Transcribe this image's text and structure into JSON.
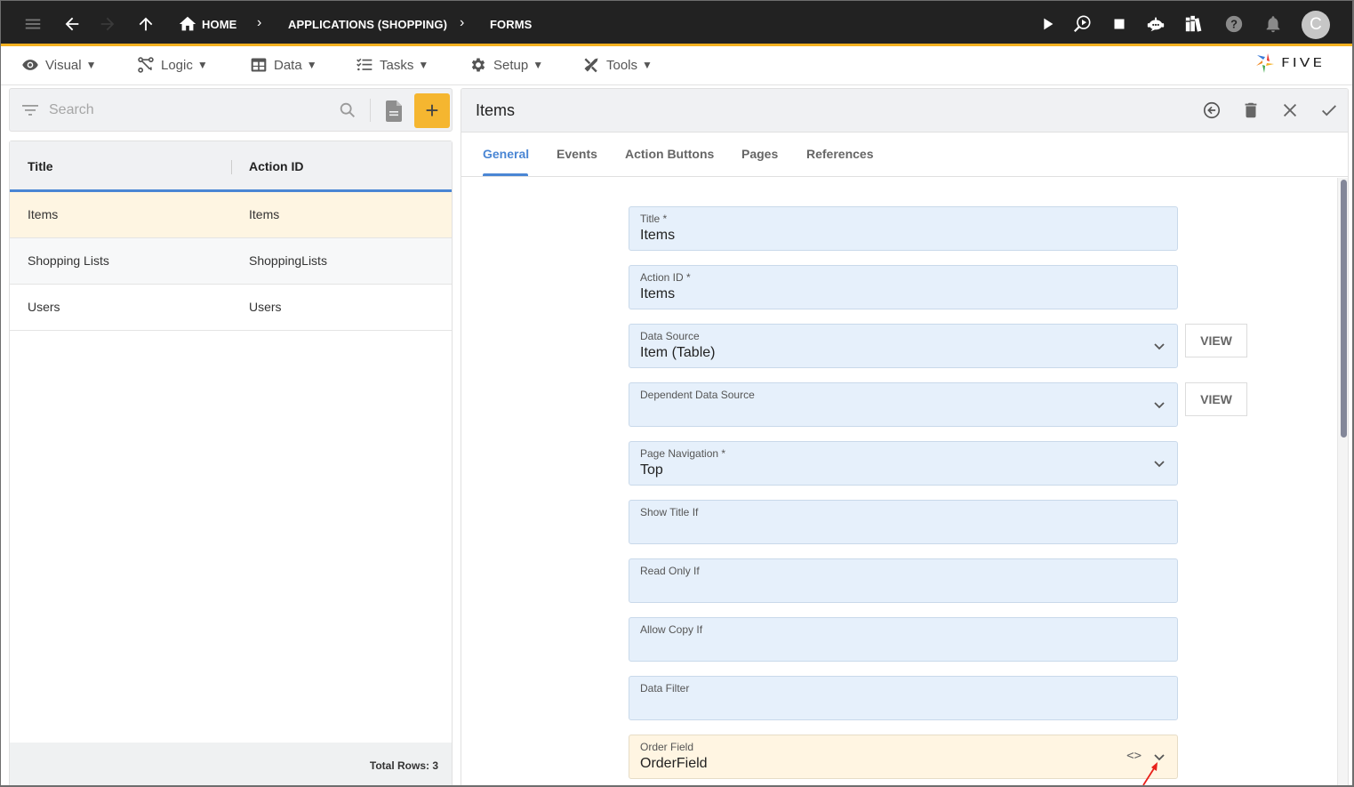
{
  "topbar": {
    "breadcrumbs": [
      "HOME",
      "APPLICATIONS (SHOPPING)",
      "FORMS"
    ],
    "avatar_initial": "C",
    "icons": [
      "menu-icon",
      "back-arrow-icon",
      "forward-arrow-icon",
      "up-arrow-icon",
      "home-icon",
      "run-icon",
      "inspect-run-icon",
      "stop-icon",
      "chat-bot-icon",
      "library-icon",
      "help-icon",
      "bell-icon"
    ]
  },
  "menubar": {
    "items": [
      {
        "label": "Visual",
        "icon": "eye-icon"
      },
      {
        "label": "Logic",
        "icon": "logic-icon"
      },
      {
        "label": "Data",
        "icon": "table-icon"
      },
      {
        "label": "Tasks",
        "icon": "checklist-icon"
      },
      {
        "label": "Setup",
        "icon": "gear-icon"
      },
      {
        "label": "Tools",
        "icon": "tools-icon"
      }
    ],
    "caret": "▼",
    "logo_text": "FIVE"
  },
  "search": {
    "placeholder": "Search",
    "value": "",
    "add_label": "+"
  },
  "list": {
    "columns": [
      "Title",
      "Action ID"
    ],
    "rows": [
      {
        "title": "Items",
        "action_id": "Items",
        "selected": true
      },
      {
        "title": "Shopping Lists",
        "action_id": "ShoppingLists",
        "selected": false
      },
      {
        "title": "Users",
        "action_id": "Users",
        "selected": false
      }
    ],
    "total_label": "Total Rows: 3"
  },
  "form": {
    "title": "Items",
    "tabs": [
      "General",
      "Events",
      "Action Buttons",
      "Pages",
      "References"
    ],
    "active_tab": "General",
    "fields": [
      {
        "label": "Title *",
        "value": "Items"
      },
      {
        "label": "Action ID *",
        "value": "Items"
      },
      {
        "label": "Data Source",
        "value": "Item (Table)"
      },
      {
        "label": "Dependent Data Source",
        "value": ""
      },
      {
        "label": "Page Navigation *",
        "value": "Top"
      },
      {
        "label": "Show Title If",
        "value": ""
      },
      {
        "label": "Read Only If",
        "value": ""
      },
      {
        "label": "Allow Copy If",
        "value": ""
      },
      {
        "label": "Data Filter",
        "value": ""
      },
      {
        "label": "Order Field",
        "value": "OrderField"
      }
    ],
    "view_label": "VIEW",
    "code_icon_label": "<>"
  },
  "colors": {
    "accent": "#4a86d4",
    "brand_yellow": "#f5b120",
    "topbar_bg": "#222222",
    "field_bg": "#e6f0fb",
    "highlight_bg": "#fff5e2",
    "annotation_arrow": "#e8201a"
  }
}
